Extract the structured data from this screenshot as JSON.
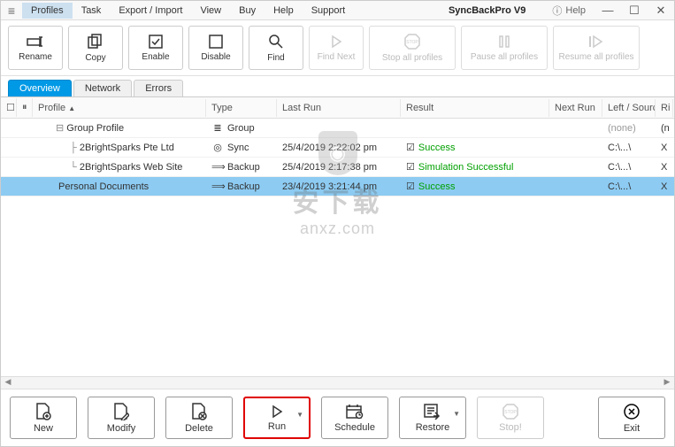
{
  "titlebar": {
    "menu": [
      "Profiles",
      "Task",
      "Export / Import",
      "View",
      "Buy",
      "Help",
      "Support"
    ],
    "app_title": "SyncBackPro V9",
    "help": "Help"
  },
  "toolbar": [
    {
      "name": "rename-button",
      "label": "Rename",
      "icon": "rename",
      "enabled": true
    },
    {
      "name": "copy-button",
      "label": "Copy",
      "icon": "copy",
      "enabled": true
    },
    {
      "name": "enable-button",
      "label": "Enable",
      "icon": "checkbox",
      "enabled": true
    },
    {
      "name": "disable-button",
      "label": "Disable",
      "icon": "square",
      "enabled": true
    },
    {
      "name": "find-button",
      "label": "Find",
      "icon": "search",
      "enabled": true
    },
    {
      "name": "find-next-button",
      "label": "Find Next",
      "icon": "play",
      "enabled": false
    },
    {
      "name": "stop-all-button",
      "label": "Stop all profiles",
      "icon": "stop",
      "enabled": false,
      "wide": true
    },
    {
      "name": "pause-all-button",
      "label": "Pause all profiles",
      "icon": "pause",
      "enabled": false,
      "wide": true
    },
    {
      "name": "resume-all-button",
      "label": "Resume all profiles",
      "icon": "resume",
      "enabled": false,
      "wide": true
    }
  ],
  "tabs": [
    {
      "label": "Overview",
      "active": true
    },
    {
      "label": "Network",
      "active": false
    },
    {
      "label": "Errors",
      "active": false
    }
  ],
  "columns": {
    "profile": "Profile",
    "type": "Type",
    "lastrun": "Last Run",
    "result": "Result",
    "nextrun": "Next Run",
    "left": "Left / Source",
    "ri": "Ri"
  },
  "rows": [
    {
      "indent": 0,
      "tree": "⊟",
      "profile": "Group Profile",
      "type_icon": "list",
      "type": "Group",
      "lastrun": "",
      "check": false,
      "result": "",
      "result_class": "",
      "nextrun": "",
      "left": "(none)",
      "left_class": "result-none",
      "ri": "(n",
      "selected": false
    },
    {
      "indent": 1,
      "tree": "├",
      "profile": "2BrightSparks Pte Ltd",
      "type_icon": "sync",
      "type": "Sync",
      "lastrun": "25/4/2019 2:22:02 pm",
      "check": true,
      "result": "Success",
      "result_class": "result-success",
      "nextrun": "",
      "left": "C:\\...\\",
      "left_class": "",
      "ri": "X",
      "selected": false
    },
    {
      "indent": 1,
      "tree": "└",
      "profile": "2BrightSparks Web Site",
      "type_icon": "arrow",
      "type": "Backup",
      "lastrun": "25/4/2019 2:17:38 pm",
      "check": true,
      "result": "Simulation Successful",
      "result_class": "result-success",
      "nextrun": "",
      "left": "C:\\...\\",
      "left_class": "",
      "ri": "X",
      "selected": false
    },
    {
      "indent": 0,
      "tree": "",
      "profile": "Personal Documents",
      "type_icon": "arrow",
      "type": "Backup",
      "lastrun": "23/4/2019 3:21:44 pm",
      "check": true,
      "result": "Success",
      "result_class": "result-success",
      "nextrun": "",
      "left": "C:\\...\\",
      "left_class": "",
      "ri": "X",
      "selected": true
    }
  ],
  "watermark": {
    "cn": "安下载",
    "en": "anxz.com"
  },
  "bottom": [
    {
      "name": "new-button",
      "label": "New",
      "icon": "doc-plus",
      "caret": false,
      "enabled": true
    },
    {
      "name": "modify-button",
      "label": "Modify",
      "icon": "doc-edit",
      "caret": false,
      "enabled": true
    },
    {
      "name": "delete-button",
      "label": "Delete",
      "icon": "doc-x",
      "caret": false,
      "enabled": true
    },
    {
      "name": "run-button",
      "label": "Run",
      "icon": "play",
      "caret": true,
      "enabled": true,
      "highlight": true
    },
    {
      "name": "schedule-button",
      "label": "Schedule",
      "icon": "calendar",
      "caret": false,
      "enabled": true
    },
    {
      "name": "restore-button",
      "label": "Restore",
      "icon": "restore",
      "caret": true,
      "enabled": true
    },
    {
      "name": "stop-button",
      "label": "Stop!",
      "icon": "stop",
      "caret": false,
      "enabled": false
    }
  ],
  "exit": {
    "label": "Exit"
  }
}
